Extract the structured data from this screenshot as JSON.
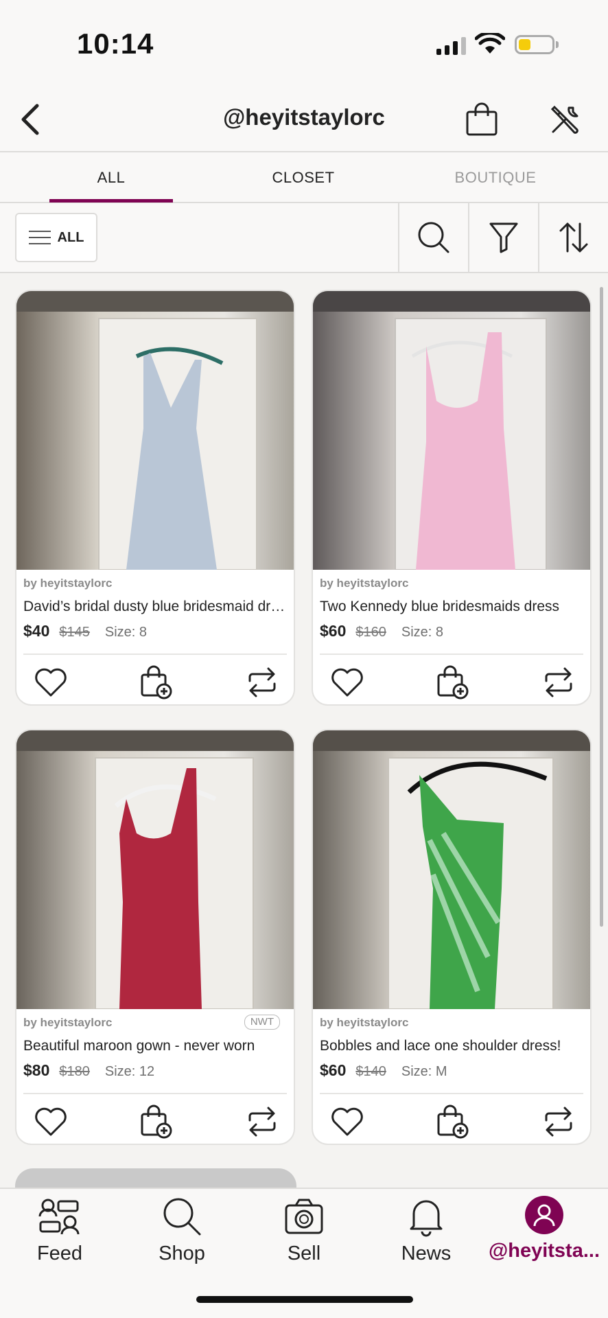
{
  "status_bar": {
    "time": "10:14"
  },
  "header": {
    "title": "@heyitstaylorc"
  },
  "tabs": [
    {
      "label": "ALL"
    },
    {
      "label": "CLOSET"
    },
    {
      "label": "BOUTIQUE"
    }
  ],
  "filter": {
    "all_label": "ALL"
  },
  "listings": [
    {
      "by": "by heyitstaylorc",
      "title": "David’s bridal dusty blue bridesmaid dress",
      "price": "$40",
      "original_price": "$145",
      "size": "Size: 8",
      "badge": "",
      "dress_color": "#b9c6d6"
    },
    {
      "by": "by heyitstaylorc",
      "title": "Two Kennedy blue bridesmaids dress",
      "price": "$60",
      "original_price": "$160",
      "size": "Size: 8",
      "badge": "",
      "dress_color": "#f0b8d2"
    },
    {
      "by": "by heyitstaylorc",
      "title": "Beautiful maroon gown - never worn",
      "price": "$80",
      "original_price": "$180",
      "size": "Size: 12",
      "badge": "NWT",
      "dress_color": "#b0273f"
    },
    {
      "by": "by heyitstaylorc",
      "title": "Bobbles and lace one shoulder dress!",
      "price": "$60",
      "original_price": "$140",
      "size": "Size: M",
      "badge": "",
      "dress_color": "#3fa54a"
    }
  ],
  "bottom_nav": [
    {
      "label": "Feed",
      "icon": "feed-icon"
    },
    {
      "label": "Shop",
      "icon": "search-icon"
    },
    {
      "label": "Sell",
      "icon": "camera-icon"
    },
    {
      "label": "News",
      "icon": "bell-icon"
    },
    {
      "label": "@heyitsta...",
      "icon": "profile-icon"
    }
  ],
  "colors": {
    "brand": "#7f0353"
  }
}
